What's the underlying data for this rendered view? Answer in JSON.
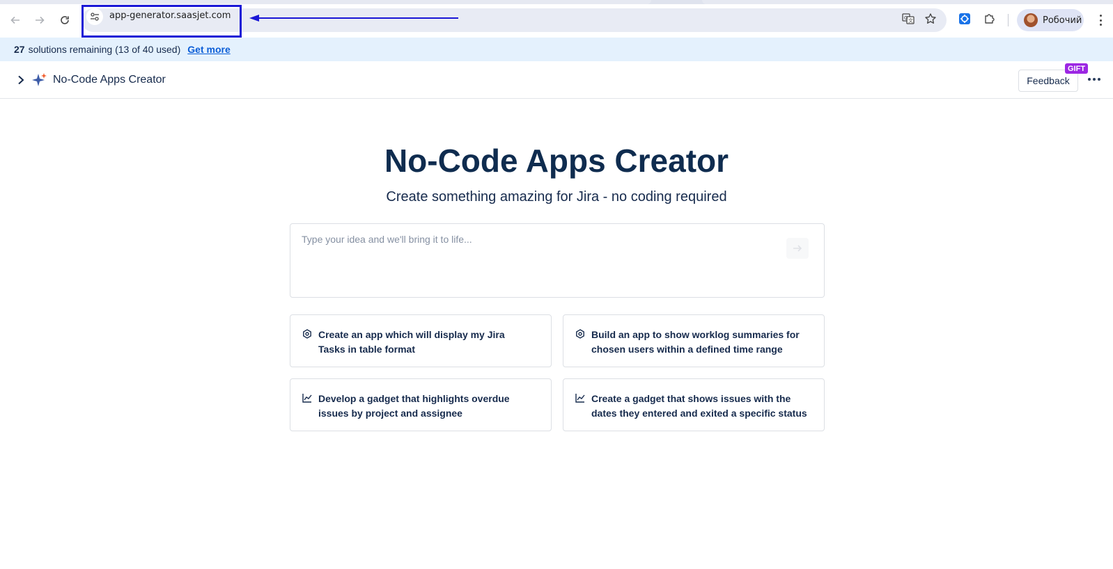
{
  "browser": {
    "url": "app-generator.saasjet.com",
    "profile_label": "Робочий",
    "icons": [
      "back-arrow-icon",
      "forward-arrow-icon",
      "reload-icon",
      "site-settings-icon",
      "translate-icon",
      "bookmark-star-icon",
      "extension-icon",
      "puzzle-icon",
      "kebab-menu-icon"
    ],
    "annotation_color": "#1a17d6"
  },
  "banner": {
    "count": "27",
    "text": "solutions remaining (13 of 40 used)",
    "link_label": "Get more"
  },
  "header": {
    "app_name": "No-Code Apps Creator",
    "feedback_label": "Feedback",
    "gift_badge": "GIFT"
  },
  "hero": {
    "title": "No-Code Apps Creator",
    "subtitle": "Create something amazing for Jira - no coding required",
    "input_placeholder": "Type your idea and we'll bring it to life..."
  },
  "suggestions": [
    {
      "icon": "hexagon-icon",
      "text": "Create an app which will display my Jira Tasks in table format"
    },
    {
      "icon": "hexagon-icon",
      "text": "Build an app to show worklog summaries for chosen users within a defined time range"
    },
    {
      "icon": "line-chart-icon",
      "text": "Develop a gadget that highlights overdue issues by project and assignee"
    },
    {
      "icon": "line-chart-icon",
      "text": "Create a gadget that shows issues with the dates they entered and exited a specific status"
    }
  ],
  "colors": {
    "banner_bg": "#e4f1fd",
    "link": "#0b5ed7",
    "gift": "#9c27e3",
    "title": "#0f2c4f"
  }
}
